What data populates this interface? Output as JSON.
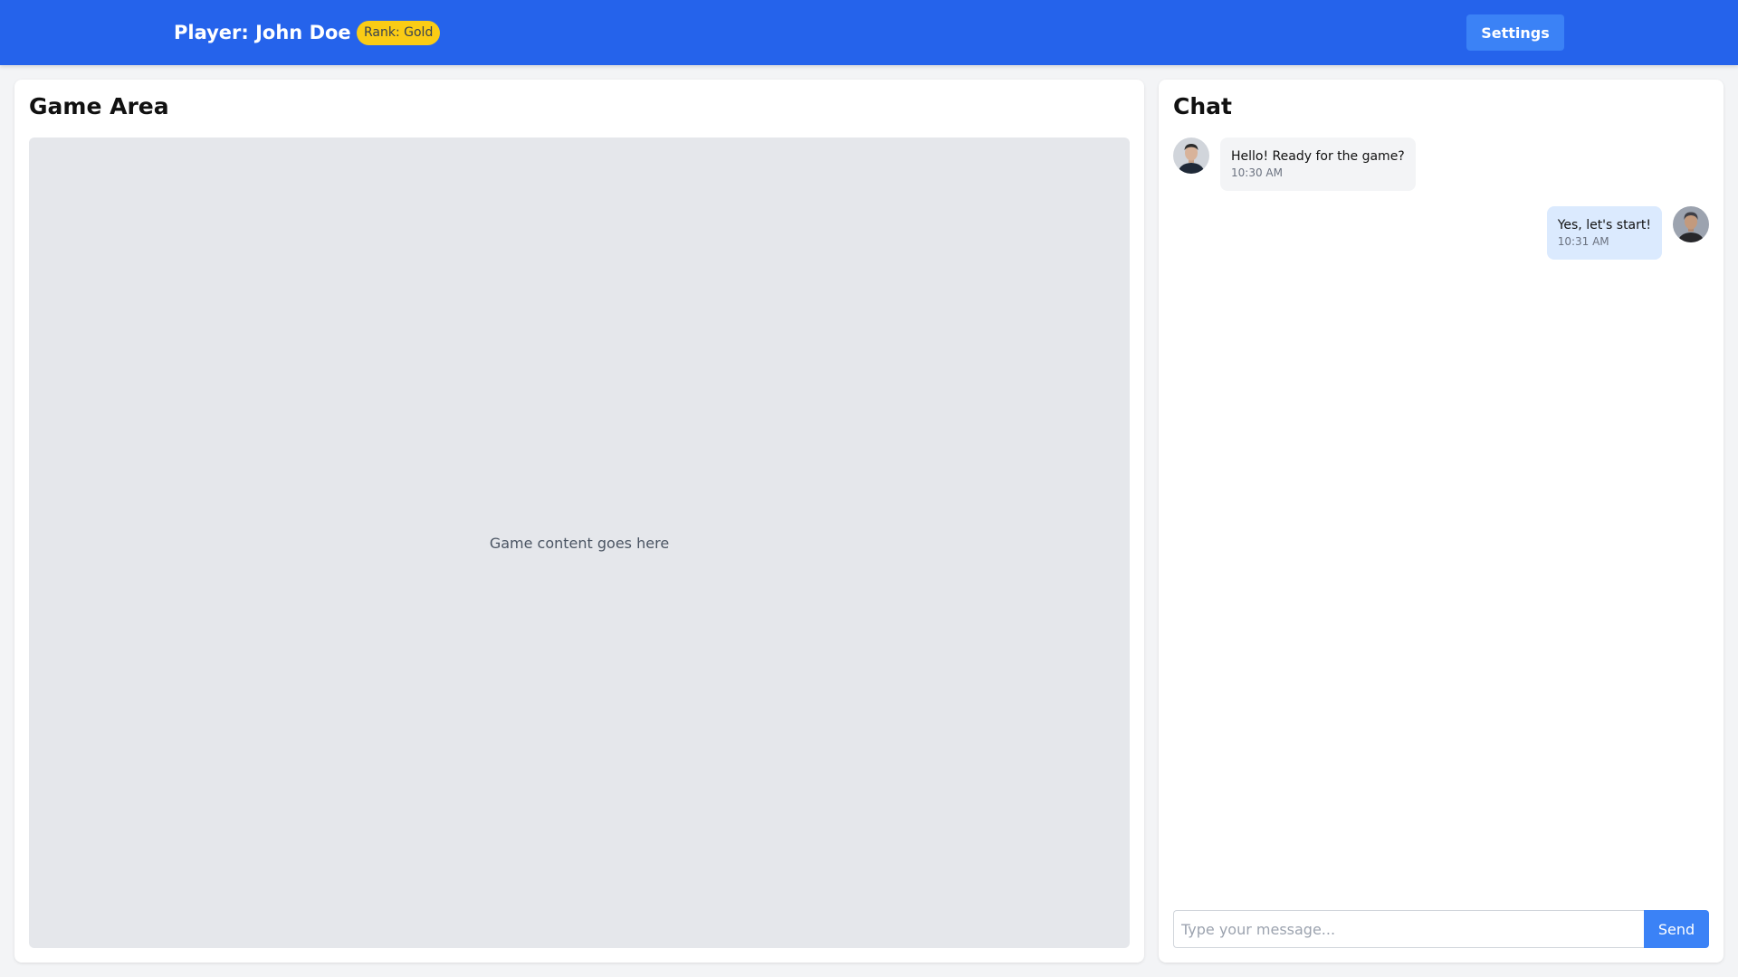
{
  "header": {
    "player_label": "Player: John Doe",
    "rank_label": "Rank: Gold",
    "settings_label": "Settings"
  },
  "game": {
    "title": "Game Area",
    "placeholder": "Game content goes here"
  },
  "chat": {
    "title": "Chat",
    "messages": [
      {
        "side": "left",
        "text": "Hello! Ready for the game?",
        "time": "10:30 AM",
        "avatar": "user-avatar-icon"
      },
      {
        "side": "right",
        "text": "Yes, let's start!",
        "time": "10:31 AM",
        "avatar": "user-avatar-icon"
      }
    ],
    "input_placeholder": "Type your message...",
    "input_value": "",
    "send_label": "Send"
  },
  "colors": {
    "header_bg": "#2563eb",
    "accent": "#3b82f6",
    "rank_badge": "#facc15",
    "incoming_bubble": "#f3f4f6",
    "outgoing_bubble": "#dbeafe"
  }
}
